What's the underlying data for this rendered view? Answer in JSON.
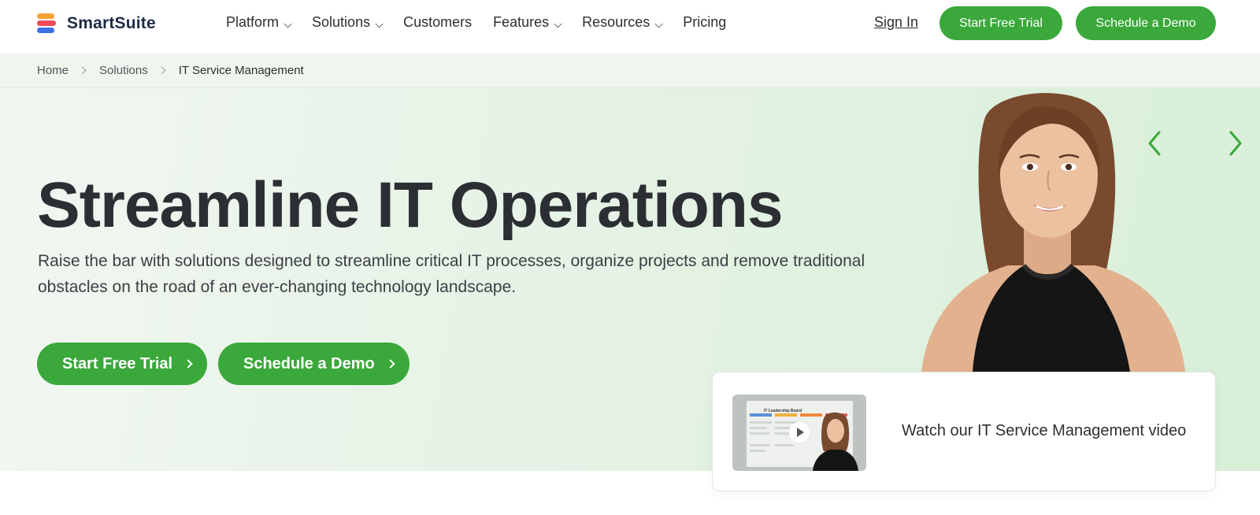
{
  "header": {
    "logo_text": "SmartSuite",
    "nav": [
      {
        "label": "Platform",
        "has_menu": true
      },
      {
        "label": "Solutions",
        "has_menu": true
      },
      {
        "label": "Customers",
        "has_menu": false
      },
      {
        "label": "Features",
        "has_menu": true
      },
      {
        "label": "Resources",
        "has_menu": true
      },
      {
        "label": "Pricing",
        "has_menu": false
      }
    ],
    "sign_in": "Sign In",
    "trial_button": "Start Free Trial",
    "demo_button": "Schedule a Demo"
  },
  "breadcrumb": [
    "Home",
    "Solutions",
    "IT Service Management"
  ],
  "hero": {
    "title": "Streamline IT Operations",
    "subtitle": "Raise the bar with solutions designed to streamline critical IT processes, organize projects and remove traditional obstacles on the road of an ever-changing technology landscape.",
    "trial_button": "Start Free Trial",
    "demo_button": "Schedule a Demo"
  },
  "video": {
    "thumbnail_caption": "IT Leadership Board",
    "label": "Watch our IT Service Management video"
  },
  "colors": {
    "accent_green": "#3aa83a",
    "text_dark": "#2b2f33",
    "hero_bg": "#e7f3e7"
  }
}
